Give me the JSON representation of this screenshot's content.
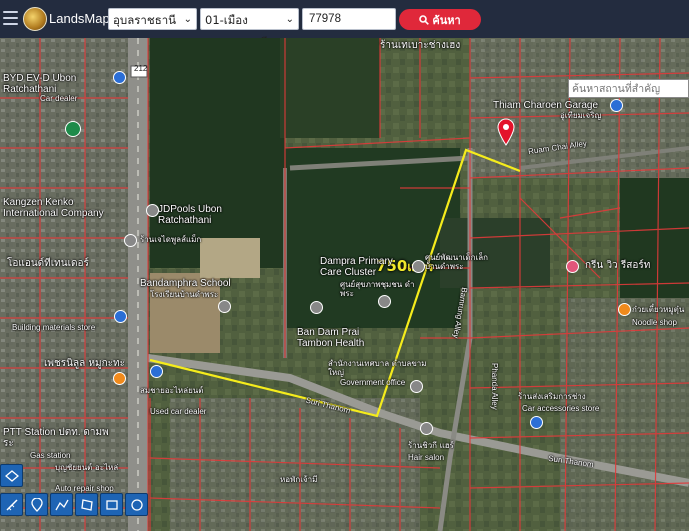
{
  "header": {
    "brand": "LandsMaps",
    "province_select": "อุบลราชธานี",
    "district_select": "01-เมืองอุบลราชธานี",
    "parcel_number": "77978",
    "search_button": "ค้นหา"
  },
  "map": {
    "place_search_placeholder": "ค้นหาสถานที่สำคัญ",
    "distance_value": "750",
    "distance_unit": "เมตร",
    "route_color": "#f5ec1c",
    "marker_color": "#e3122a",
    "labels": {
      "byd": "BYD EV-D Ubon Ratchathani",
      "byd_sub": "Car dealer",
      "kangzen": "Kangzen Kenko International Company",
      "jdpools": "JDPools Ubon Ratchathani",
      "jdpools_thai": "ร้านเจไดพูลส์แม็ก",
      "bandamphra_school": "Bandamphra School",
      "bandamphra_school_thai": "โรงเรียนบ้านดำพระ",
      "dampra_care": "Dampra Primary Care Cluster",
      "dampra_care_thai": "ศูนย์สุขภาพชุมชน ดำพระ",
      "ban_dam_prai": "Ban Dam Prai Tambon Health",
      "thiam_charoen": "Thiam Charoen Garage",
      "garage_thai": "อู่เทียมเจริญ",
      "ruam_chai": "Ruam Chai Alley",
      "sunthanom1": "Suri Thanom",
      "sunthanom2": "Suri Thanom",
      "gov_office": "Government office",
      "gov_office_thai": "สำนักงานเทศบาล ตำบลขามใหญ่",
      "phanda_alley": "Phanda Alley",
      "bamrung_alley": "Bamrung Alley",
      "ptt": "PTT Station ปตท. ดามพระ",
      "ptt_sub": "Gas station",
      "building_store": "Building materials store",
      "used_car": "Used car dealer",
      "car_access": "Car accessories store",
      "car_access_thai": "ร้านส่งเสริมการช่าง",
      "hair_salon": "Hair salon",
      "hair_thai": "ร้านชิวกี แฮร์",
      "noodle_shop": "Noodle shop",
      "noodle_thai": "ก๋วยเตี๋ยวหมูตุ๋น",
      "resort_thai": "กรีน วิว รีสอร์ท",
      "auto_repair": "Auto repair shop",
      "auto_repair_thai": "บุญชัยยนต์ อะไหล่",
      "shop_top": "ร้านเทเบาะช่างเฮง",
      "nursery_thai": "ศูนย์พัฒนาเด็กเล็ก บ้านดำพระ",
      "phet_thai": "เพชรนิลูล หมูกะทะ",
      "so_thai": "โอแอนด์ทีเทนเดอร์",
      "petrol_thai": "สมชายอะไหล่ยนต์",
      "road_212": "212",
      "hotel_thai": "หอพักเจ้ามี"
    }
  }
}
